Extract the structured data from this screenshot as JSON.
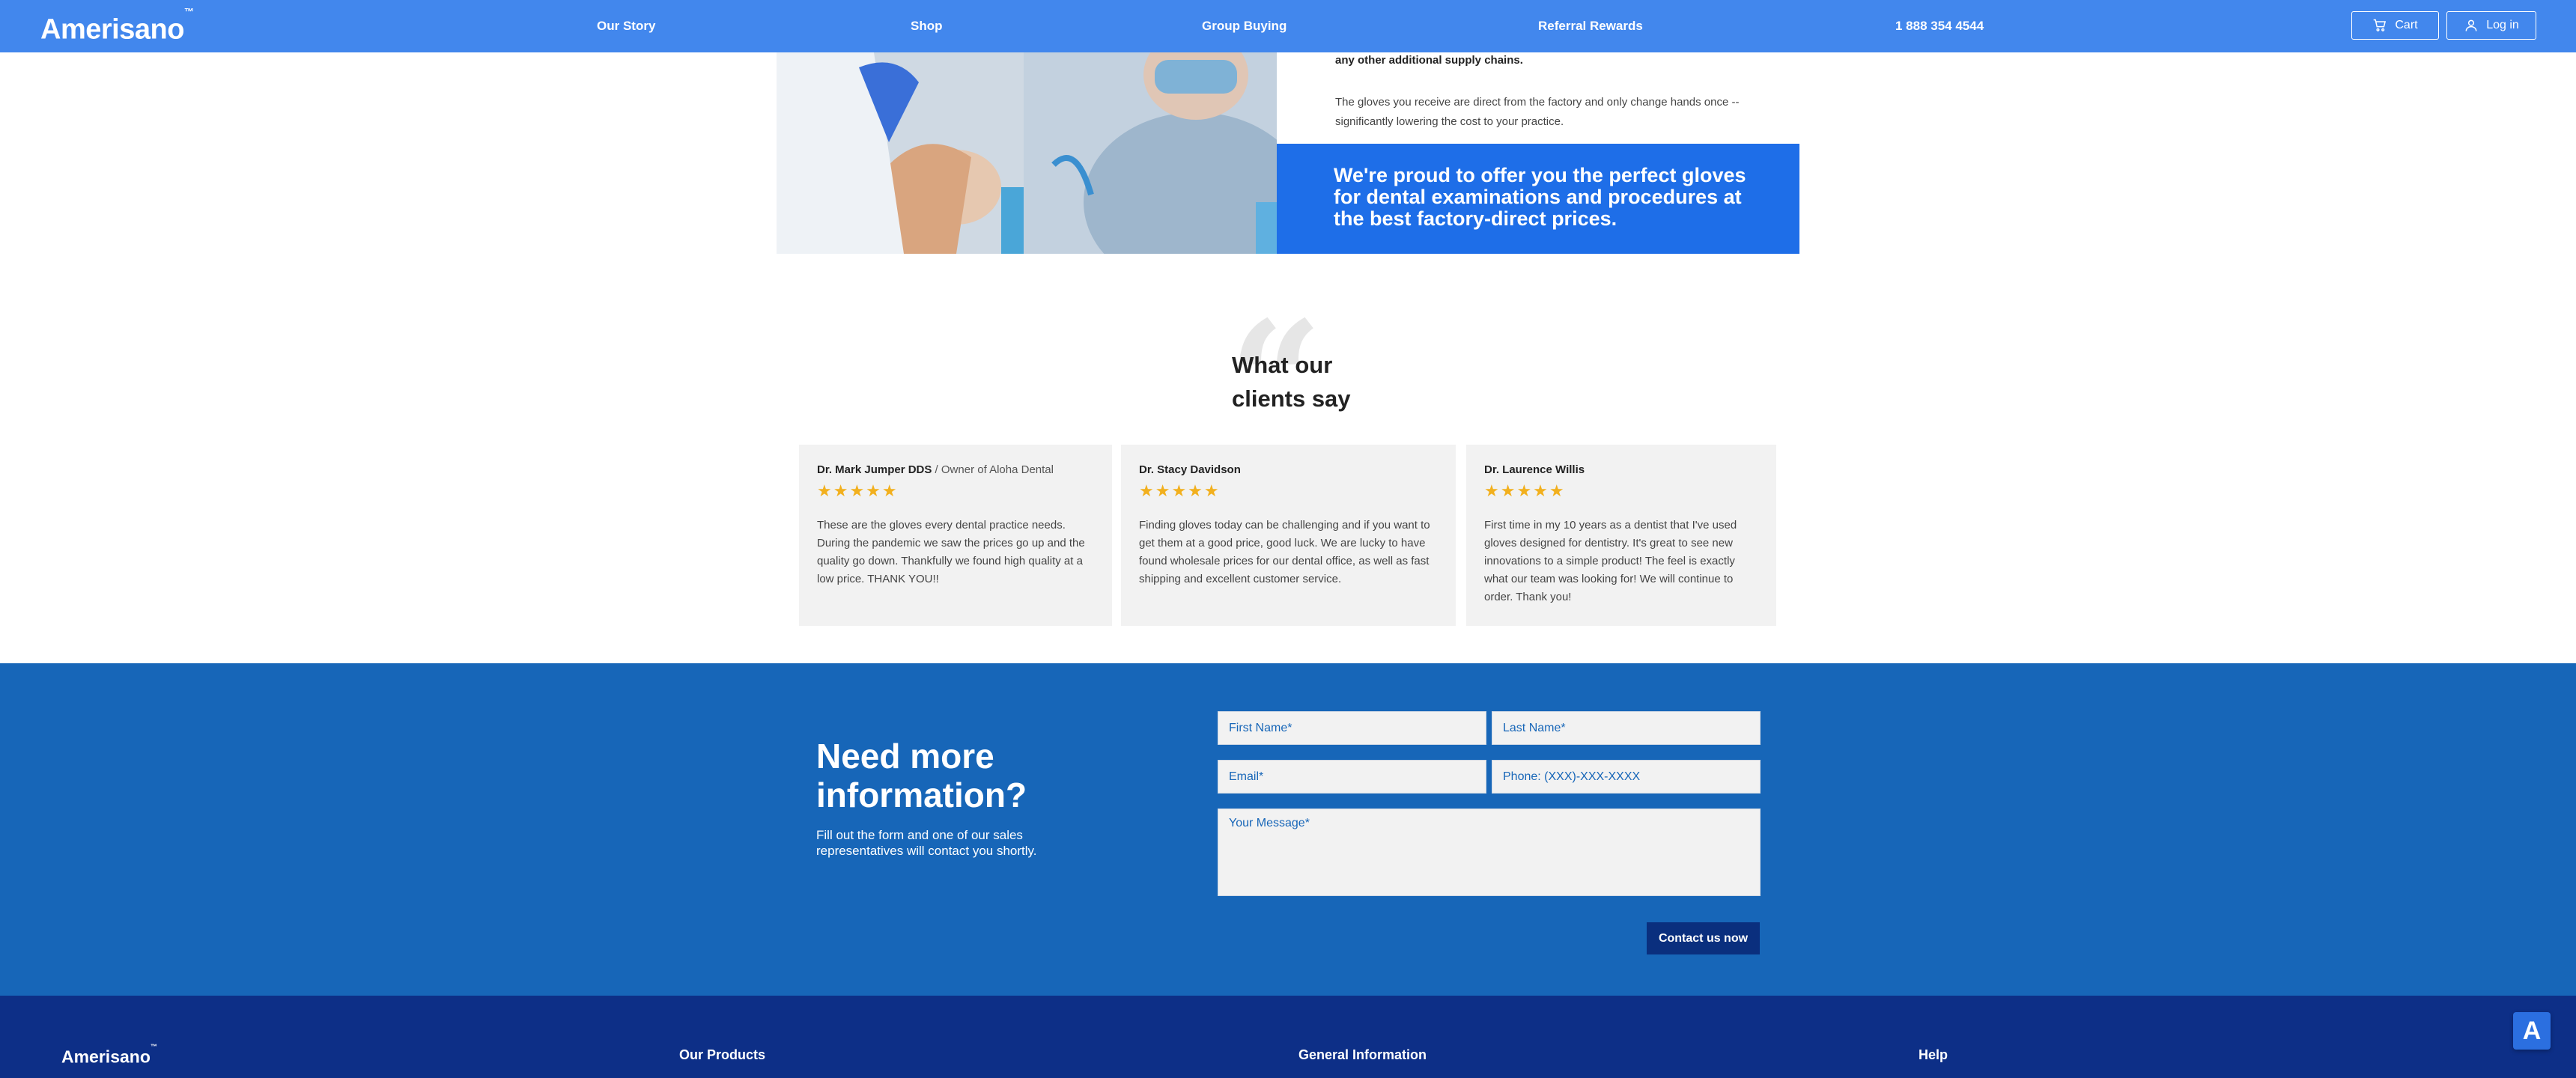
{
  "nav": {
    "logo": "Amerisano",
    "logo_tm": "™",
    "links": [
      "Our Story",
      "Shop",
      "Group Buying",
      "Referral Rewards",
      "1 888 354 4544"
    ],
    "cart_label": "Cart",
    "login_label": "Log in"
  },
  "hero": {
    "bold_line": "any other additional supply chains.",
    "paragraph": "The gloves you receive are direct from the factory and only change hands once -- significantly lowering the cost to your practice.",
    "banner": "We're proud to offer you the perfect gloves for dental examinations and procedures at the best factory-direct prices."
  },
  "testimonials": {
    "quote_glyph": "“",
    "title": "What our clients say",
    "rating_glyph": "★★★★★",
    "cards": [
      {
        "name": "Dr. Mark Jumper DDS",
        "role": " / Owner of Aloha Dental",
        "rating": 5,
        "text": "These are the gloves every dental practice needs. During the pandemic we saw the prices go up and the quality go down. Thankfully we found high quality at a low price. THANK YOU!!"
      },
      {
        "name": "Dr. Stacy Davidson",
        "role": "",
        "rating": 5,
        "text": "Finding gloves today can be challenging and if you want to get them at a good price, good luck. We are lucky to have found wholesale prices for our dental office, as well as fast shipping and excellent customer service."
      },
      {
        "name": "Dr. Laurence Willis",
        "role": "",
        "rating": 5,
        "text": "First time in my 10 years as a dentist that I've used gloves designed for dentistry. It's great to see new innovations to a simple product! The feel is exactly what our team was looking for! We will continue to order. Thank you!"
      }
    ]
  },
  "contact": {
    "title": "Need more information?",
    "subtitle": "Fill out the form and one of our sales representatives will contact you shortly.",
    "first_name_placeholder": "First Name*",
    "last_name_placeholder": "Last Name*",
    "email_placeholder": "Email*",
    "phone_placeholder": "Phone: (XXX)-XXX-XXXX",
    "message_placeholder": "Your Message*",
    "submit_label": "Contact us now"
  },
  "footer": {
    "logo": "Amerisano",
    "logo_tm": "™",
    "headings": [
      "Our Products",
      "General Information",
      "Help"
    ]
  },
  "chat_badge": "A",
  "colors": {
    "nav_blue": "#4287ed",
    "banner_blue": "#1e6ee8",
    "contact_blue": "#1766b8",
    "footer_navy": "#0d2f87",
    "button_navy": "#0a2f7e",
    "star_gold": "#f2b01e"
  }
}
